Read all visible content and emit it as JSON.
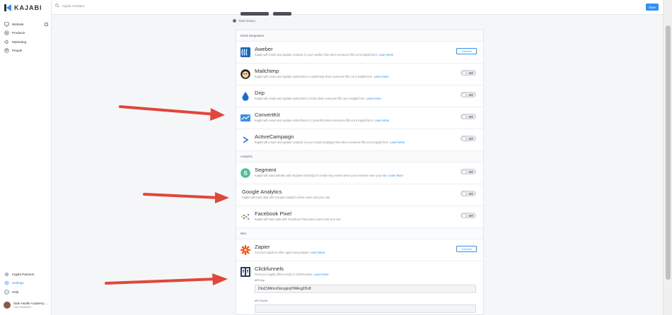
{
  "brand": {
    "name": "KAJABI"
  },
  "topbar": {
    "search_placeholder": "Kajabi Assistant",
    "save_label": "Save"
  },
  "sidebar": {
    "items": [
      {
        "label": "Website",
        "icon": "monitor-icon"
      },
      {
        "label": "Products",
        "icon": "products-icon"
      },
      {
        "label": "Marketing",
        "icon": "megaphone-icon"
      },
      {
        "label": "People",
        "icon": "people-icon"
      }
    ],
    "bottom": [
      {
        "label": "Kajabi Partners",
        "icon": "partners-icon"
      },
      {
        "label": "Settings",
        "icon": "gear-icon"
      },
      {
        "label": "Help",
        "icon": "help-icon"
      }
    ],
    "account": {
      "name": "Side Hustle Academy ...",
      "role": "Tony Hostrados"
    }
  },
  "page": {
    "task_history": "Task History"
  },
  "sections": {
    "email": "Email Integrations",
    "analytics": "Analytics",
    "misc": "Misc"
  },
  "integrations": {
    "aweber": {
      "title": "Aweber",
      "desc": "Kajabi will create and update contacts in your Aweber lists when someone fills out a Kajabi form.",
      "learn": "Learn More",
      "action": "Connect"
    },
    "mailchimp": {
      "title": "Mailchimp",
      "desc": "Kajabi will create and update subscribers in mailchimp when someone fills out a Kajabi form.",
      "learn": "Learn More",
      "toggle": "OFF"
    },
    "drip": {
      "title": "Drip",
      "desc": "Kajabi will create and update subscribers in Drip when someone fills out a Kajabi form.",
      "learn": "Learn More",
      "toggle": "OFF"
    },
    "convertkit": {
      "title": "ConvertKit",
      "desc": "Kajabi will create and update subscribers in ConvertKit when someone fills out a Kajabi form.",
      "learn": "Learn More",
      "toggle": "OFF"
    },
    "activecampaign": {
      "title": "ActiveCampaign",
      "desc": "Kajabi will create and update contacts in your ActiveCampaign lists when someone fills out a Kajabi form.",
      "learn": "Learn More",
      "toggle": "OFF"
    },
    "segment": {
      "title": "Segment",
      "desc": "Kajabi will automatically add Segment tracking for certain key events when your member uses your site.",
      "learn": "Learn More",
      "toggle": "OFF"
    },
    "google_analytics": {
      "title": "Google Analytics",
      "desc": "Kajabi will track data with Google Analytics when users visit your site.",
      "toggle": "OFF"
    },
    "facebook_pixel": {
      "title": "Facebook Pixel",
      "desc": "Kajabi will track data with Facebook Pixel when users visit your site.",
      "toggle": "OFF"
    },
    "zapier": {
      "title": "Zapier",
      "desc": "Connect Kajabi to 500+ apps using Zapier.",
      "learn": "Learn More",
      "action": "Connect"
    },
    "clickfunnels": {
      "title": "Clickfunnels",
      "desc": "Find your Kajabi offers easily in ClickFunnels.",
      "learn": "Learn More",
      "api_key_label": "API Key",
      "api_key_value": "DIoZ1MmcnSocygnqYMAcg2Dv8",
      "api_secret_label": "API Secret"
    }
  },
  "colors": {
    "accent": "#2e91fc",
    "arrow": "#e0463a"
  }
}
